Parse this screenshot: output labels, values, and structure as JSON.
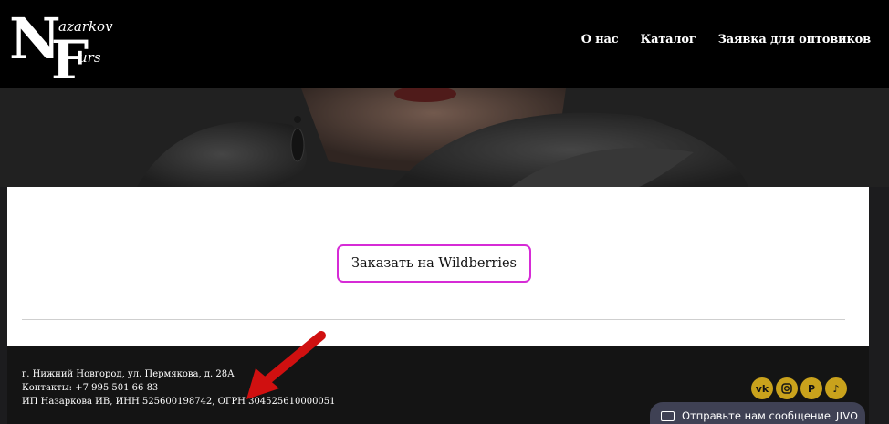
{
  "logo": {
    "letters": "NF",
    "word1": "azarkov",
    "word2": "urs"
  },
  "nav": {
    "items": [
      "О нас",
      "Каталог",
      "Заявка для оптовиков"
    ]
  },
  "cta": {
    "label": "Заказать на Wildberries"
  },
  "footer": {
    "address": "г. Нижний Новгород, ул. Пермякова, д. 28А",
    "contacts": "Контакты: +7 995 501 66 83",
    "legal": "ИП Назаркова ИВ, ИНН 525600198742, ОГРН 304525610000051"
  },
  "social": [
    "vk",
    "instagram",
    "pinterest",
    "tiktok"
  ],
  "jivo": {
    "label": "Отправьте нам сообщение",
    "brand": "JIVO"
  },
  "colors": {
    "header_bg": "#000000",
    "cta_border": "#d62bd6",
    "social": "#c9a21c",
    "arrow": "#d01010",
    "jivo_bg": "#3f4154"
  }
}
